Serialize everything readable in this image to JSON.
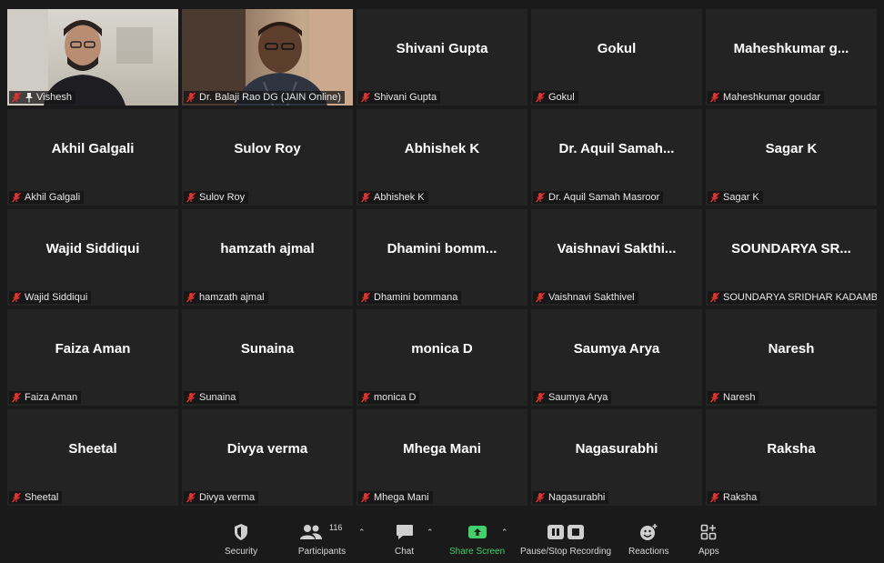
{
  "participants": [
    {
      "name": "Vishesh",
      "display": "",
      "video": true,
      "pinned": true
    },
    {
      "name": "Dr. Balaji Rao DG (JAIN Online)",
      "display": "",
      "video": true,
      "active": true
    },
    {
      "name": "Shivani Gupta",
      "display": "Shivani Gupta"
    },
    {
      "name": "Gokul",
      "display": "Gokul"
    },
    {
      "name": "Maheshkumar goudar",
      "display": "Maheshkumar g..."
    },
    {
      "name": "Akhil Galgali",
      "display": "Akhil Galgali"
    },
    {
      "name": "Sulov Roy",
      "display": "Sulov Roy"
    },
    {
      "name": "Abhishek K",
      "display": "Abhishek K"
    },
    {
      "name": "Dr. Aquil Samah Masroor",
      "display": "Dr. Aquil Samah..."
    },
    {
      "name": "Sagar K",
      "display": "Sagar K"
    },
    {
      "name": "Wajid Siddiqui",
      "display": "Wajid Siddiqui"
    },
    {
      "name": "hamzath ajmal",
      "display": "hamzath ajmal"
    },
    {
      "name": "Dhamini bommana",
      "display": "Dhamini bomm..."
    },
    {
      "name": "Vaishnavi Sakthivel",
      "display": "Vaishnavi Sakthi..."
    },
    {
      "name": "SOUNDARYA SRIDHAR KADAMBI",
      "display": "SOUNDARYA SR..."
    },
    {
      "name": "Faiza Aman",
      "display": "Faiza Aman"
    },
    {
      "name": "Sunaina",
      "display": "Sunaina"
    },
    {
      "name": "monica D",
      "display": "monica D"
    },
    {
      "name": "Saumya Arya",
      "display": "Saumya Arya"
    },
    {
      "name": "Naresh",
      "display": "Naresh"
    },
    {
      "name": "Sheetal",
      "display": "Sheetal"
    },
    {
      "name": "Divya verma",
      "display": "Divya verma"
    },
    {
      "name": "Mhega Mani",
      "display": "Mhega Mani"
    },
    {
      "name": "Nagasurabhi",
      "display": "Nagasurabhi"
    },
    {
      "name": "Raksha",
      "display": "Raksha"
    }
  ],
  "toolbar": {
    "security": "Security",
    "participants": "Participants",
    "participants_count": "116",
    "chat": "Chat",
    "share_screen": "Share Screen",
    "pause_stop_recording": "Pause/Stop Recording",
    "reactions": "Reactions",
    "apps": "Apps"
  },
  "colors": {
    "active_speaker_border": "#d8d46a",
    "share_green": "#3fd16a",
    "mute_red": "#e0312f"
  }
}
